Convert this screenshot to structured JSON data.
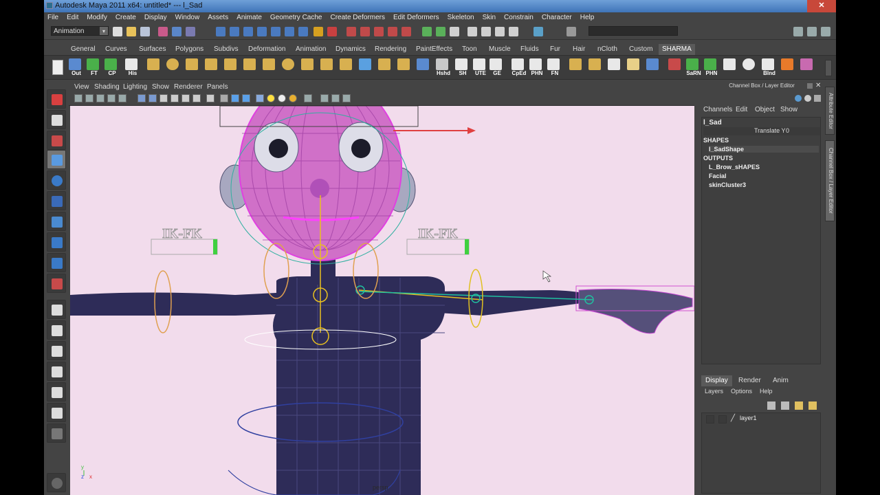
{
  "window": {
    "title": "Autodesk Maya 2011 x64: untitled*   ---   l_Sad",
    "close": "✕"
  },
  "menubar": [
    "File",
    "Edit",
    "Modify",
    "Create",
    "Display",
    "Window",
    "Assets",
    "Animate",
    "Geometry Cache",
    "Create Deformers",
    "Edit Deformers",
    "Skeleton",
    "Skin",
    "Constrain",
    "Character",
    "Help"
  ],
  "status_line": {
    "mode": "Animation",
    "mode_arrow": "▾"
  },
  "shelf_tabs": [
    "General",
    "Curves",
    "Surfaces",
    "Polygons",
    "Subdivs",
    "Deformation",
    "Animation",
    "Dynamics",
    "Rendering",
    "PaintEffects",
    "Toon",
    "Muscle",
    "Fluids",
    "Fur",
    "Hair",
    "nCloth",
    "Custom",
    "SHARMA"
  ],
  "shelf_active": "SHARMA",
  "shelf_buttons": [
    "Out",
    "FT",
    "CP",
    "His",
    "",
    "",
    "",
    "",
    "",
    "",
    "",
    "",
    "",
    "",
    "",
    "",
    "Hshd",
    "SH",
    "UTE",
    "GE",
    "CpEd",
    "PHN",
    "FN",
    "",
    "",
    "",
    "",
    "",
    "SaRN",
    "PHN",
    "",
    "",
    "Blnd",
    "",
    ""
  ],
  "panel_menu": [
    "View",
    "Shading",
    "Lighting",
    "Show",
    "Renderer",
    "Panels"
  ],
  "viewport": {
    "ik_fk_label_left": "IK-FK",
    "ik_fk_label_right": "IK-FK",
    "camera": "persp",
    "axis_y": "y",
    "axis_z": "z",
    "axis_x": "x"
  },
  "channel_box": {
    "title": "Channel Box / Layer Editor",
    "menu": [
      "Channels",
      "Edit",
      "Object",
      "Show"
    ],
    "object_name": "l_Sad",
    "attr_name": "Translate Y",
    "attr_value": "0",
    "shapes_header": "SHAPES",
    "shape": "l_SadShape",
    "outputs_header": "OUTPUTS",
    "outputs": [
      "L_Brow_sHAPES",
      "Facial",
      "skinCluster3"
    ]
  },
  "side_tabs": [
    "Attribute Editor",
    "Channel Box / Layer Editor"
  ],
  "layer_editor": {
    "tabs": [
      "Display",
      "Render",
      "Anim"
    ],
    "active_tab": "Display",
    "menu": [
      "Layers",
      "Options",
      "Help"
    ],
    "layers": [
      {
        "name": "layer1"
      }
    ]
  },
  "colors": {
    "viewport_bg": "#f2dcec",
    "maya_bg": "#444444",
    "wire_magenta": "#e040e0",
    "body_dark": "#2e2c58",
    "title_blue": "#5a8fd0"
  }
}
